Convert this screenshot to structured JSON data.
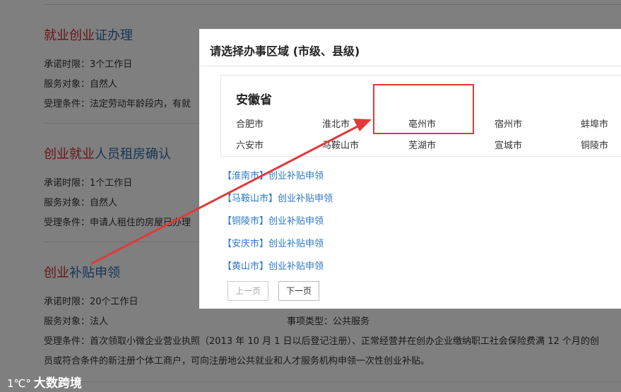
{
  "background": {
    "services": [
      {
        "title_hl": "就业创业",
        "title_rest": "证办理",
        "promise_time": "承诺时限：3个工作日",
        "target": "服务对象：自然人",
        "condition": "受理条件：法定劳动年龄段内，有就"
      },
      {
        "title_hl": "创业就业",
        "title_rest": "人员租房确认",
        "promise_time": "承诺时限：1个工作日",
        "target": "服务对象：自然人",
        "condition": "受理条件：申请人租住的房屋已办理"
      },
      {
        "title_hl": "创业",
        "title_rest": "补贴申领",
        "promise_time": "承诺时限：20个工作日",
        "target": "服务对象：法人",
        "item_type": "事项类型：公共服务",
        "condition_line1": "受理条件：首次领取小微企业营业执照（2013 年 10 月 1 日以后登记注册）、正常经营并在创办企业缴纳职工社会保险费满 12 个月的创",
        "condition_line2": "员或符合条件的新注册个体工商户，可向注册地公共就业和人才服务机构申领一次性创业补贴。"
      }
    ],
    "watermark": "大数跨境",
    "watermark_logo": "1℃°"
  },
  "modal": {
    "title": "请选择办事区域 (市级、县级)",
    "province": "安徽省",
    "cities": [
      "合肥市",
      "淮北市",
      "亳州市",
      "宿州市",
      "蚌埠市",
      "六安市",
      "马鞍山市",
      "芜湖市",
      "宣城市",
      "铜陵市"
    ],
    "results": [
      "【淮南市】创业补贴申领",
      "【马鞍山市】创业补贴申领",
      "【铜陵市】创业补贴申领",
      "【安庆市】创业补贴申领",
      "【黄山市】创业补贴申领"
    ],
    "prev_label": "上一页",
    "next_label": "下一页"
  },
  "colors": {
    "link": "#2b78c5",
    "title_blue": "#2b6cb0",
    "highlight_red": "#d12b2b",
    "annotation_red": "#e03a3a"
  }
}
